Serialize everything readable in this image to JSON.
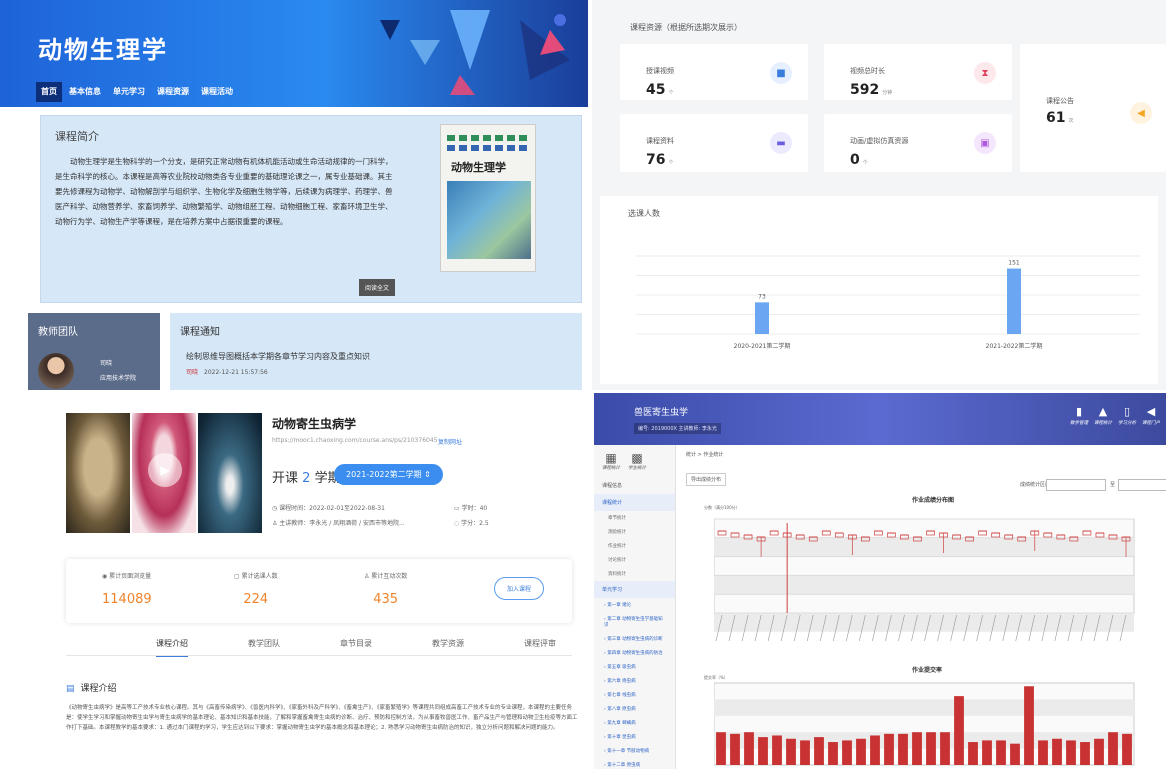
{
  "q1": {
    "title": "动物生理学",
    "nav": [
      "首页",
      "基本信息",
      "单元学习",
      "课程资源",
      "课程活动"
    ],
    "intro_heading": "课程简介",
    "intro_text": "动物生理学是生物科学的一个分支，是研究正常动物有机体机能活动或生命活动规律的一门科学，是生命科学的核心。本课程是高等农业院校动物类各专业重要的基础理论课之一，属专业基础课。其主要先修课程为动物学、动物解剖学与组织学、生物化学及细胞生物学等，后续课为病理学、药理学、兽医产科学、动物营养学、家畜饲养学、动物繁殖学、动物组胚工程、动物细胞工程、家畜环境卫生学、动物行为学、动物生产学等课程，是在培养方案中占据很重要的课程。",
    "book_title": "动物生理学",
    "read_more": "阅读全文",
    "team_heading": "教师团队",
    "teacher_name": "司晓",
    "teacher_school": "应用技术学院",
    "notice_heading": "课程通知",
    "notice_title": "绘制思维导图概括本学期各章节学习内容及重点知识",
    "notice_tag": "司晓",
    "notice_time": "2022-12-21 15:57:56"
  },
  "q2": {
    "header": "课程资源（根据所选期次展示）",
    "cards": [
      {
        "label": "授课视频",
        "value": "45",
        "unit": "个",
        "icon": "video-icon",
        "color": "#3b7ddd"
      },
      {
        "label": "视频总时长",
        "value": "592",
        "unit": "分钟",
        "icon": "hourglass-icon",
        "color": "#e0405a"
      },
      {
        "label": "课程资料",
        "value": "76",
        "unit": "个",
        "icon": "folder-icon",
        "color": "#6a5de0"
      },
      {
        "label": "动画/虚拟仿真资源",
        "value": "0",
        "unit": "个",
        "icon": "panel-icon",
        "color": "#b058e0"
      },
      {
        "label": "课程公告",
        "value": "61",
        "unit": "次",
        "icon": "speaker-icon",
        "color": "#f5a623"
      }
    ],
    "chart_heading": "选课人数"
  },
  "chart_data": [
    {
      "type": "bar",
      "title": "选课人数",
      "categories": [
        "2020-2021第二学期",
        "2021-2022第二学期"
      ],
      "values": [
        73,
        151
      ],
      "ylim": [
        0,
        180
      ],
      "grid": true
    },
    {
      "type": "bar",
      "title": "作业提交率",
      "ylabel": "提交率（%）",
      "ylim": [
        0,
        100
      ],
      "values": [
        40,
        38,
        40,
        34,
        36,
        32,
        30,
        34,
        28,
        30,
        32,
        36,
        38,
        38,
        40,
        40,
        40,
        84,
        28,
        30,
        30,
        26,
        96,
        30,
        32,
        30,
        28,
        32,
        40,
        38
      ]
    }
  ],
  "q3": {
    "course_title": "动物寄生虫病学",
    "course_url": "https://mooc1.chaoxing.com/course.ans/ps/210376045",
    "copy_link": "复制网址",
    "session_label": "开课",
    "session_num": "2",
    "session_unit": "学期",
    "term_btn": "2021-2022第二学期  ⇕",
    "period": "课程时间：2022-02-01至2022-08-31",
    "teacher": "主讲教师：李永光 / 凤翔酒荷 / 安西市等地院...",
    "hours": "学时：40",
    "credits": "学分：2.5",
    "stats": [
      {
        "label": "累计页面浏览量",
        "value": "114089"
      },
      {
        "label": "累计选课人数",
        "value": "224"
      },
      {
        "label": "累计互动次数",
        "value": "435"
      }
    ],
    "join_btn": "加入课程",
    "tabs": [
      "课程介绍",
      "教学团队",
      "章节目录",
      "教学资源",
      "课程评审"
    ],
    "section_heading": "课程介绍",
    "desc": "《动物寄生虫病学》是高等工产技术专业核心课程。其与《高畜传染病学》、《兽医内科学》、《家畜外科及产科学》、《畜禽生产》、《家畜繁殖学》等课程共同组成高畜工产技术专业的专业课程，本课程的主要任务是：使学生学习和掌握动物寄生虫学与寄生虫病学的基本理论、基本知识和基本技能，了解和掌握畜禽寄生虫病的诊断、治疗、预防和控制方法，为从事畜牧兽医工作、畜产品生产与管理和动物卫生检疫等方面工作打下基础。本课程教学的基本要求：1. 通过本门课程的学习，学生应达到以下要求：掌握动物寄生虫学的基本概念和基本理论；2. 熟悉学习动物寄生虫病防治的知识，独立分析问题和解决问题的能力。"
  },
  "q4": {
    "title": "兽医寄生虫学",
    "sub": "编号: 2019000X  主讲教师: 李永光",
    "tools": [
      "教学管理",
      "课程统计",
      "学习分析",
      "课程门户"
    ],
    "side_top": [
      "课程统计",
      "学生统计"
    ],
    "side_items": [
      "课程信息",
      "课程统计"
    ],
    "side_subs": [
      "章节统计",
      "测验统计",
      "作业统计",
      "讨论统计",
      "资料统计"
    ],
    "side_sec": "单元学习",
    "chapters": [
      "第一章 绪论",
      "第二章 动物寄生虫学基础知识",
      "第三章 动物寄生虫病的诊断",
      "第四章 动物寄生虫病的防治",
      "第五章 吸虫病",
      "第六章 绦虫病",
      "第七章 线虫病",
      "第八章 原虫病",
      "第九章 蜱螨病",
      "第十章 昆虫病",
      "第十一章 节肢动物病",
      "第十二章 原虫病"
    ],
    "crumb": "统计 > 作业统计",
    "export": "导出成绩分布",
    "filter_label": "成绩统计区间:",
    "filter_to": "至",
    "chart1_title": "作业成绩分布图",
    "chart1_ylabel": "分数（满分100分）",
    "chart2_title": "作业提交率",
    "chart2_ylabel": "提交率（%）",
    "y_ticks": [
      "100",
      "80",
      "60",
      "40",
      "20",
      "0"
    ]
  }
}
